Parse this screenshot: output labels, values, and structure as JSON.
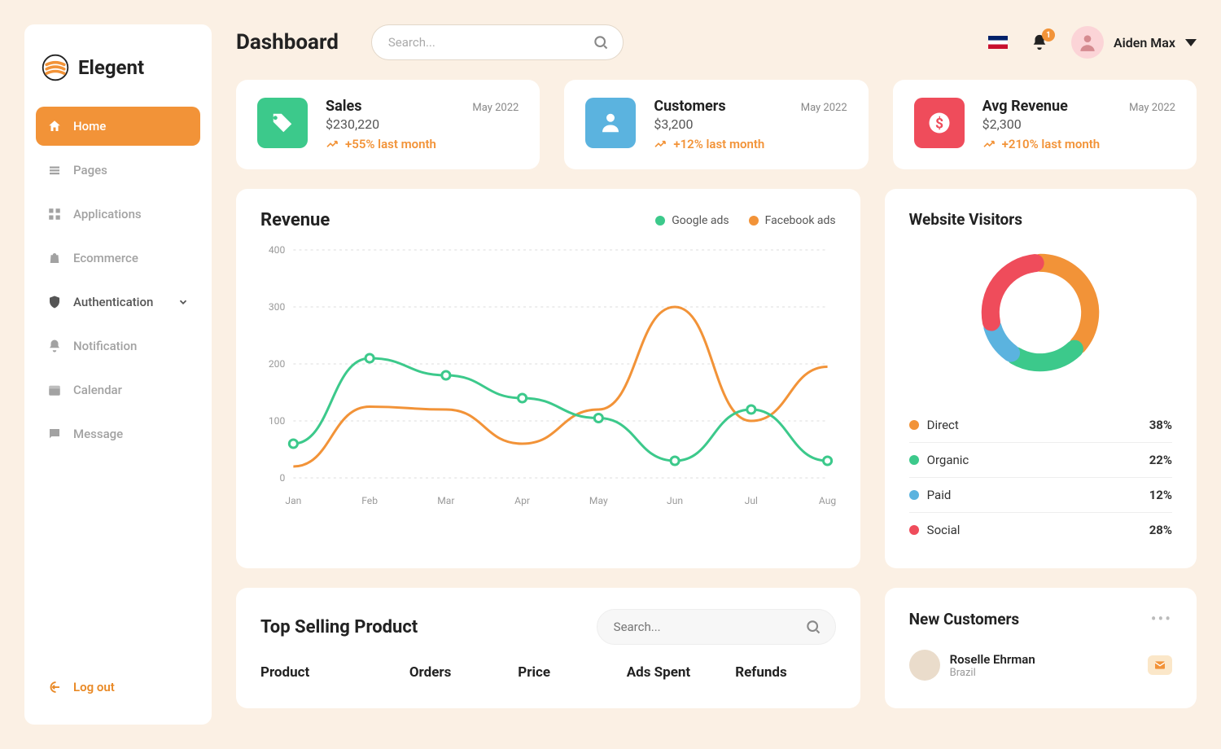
{
  "brand": "Elegent",
  "header": {
    "title": "Dashboard",
    "search_placeholder": "Search...",
    "notif_count": "1",
    "user_name": "Aiden Max"
  },
  "sidebar": {
    "items": [
      {
        "label": "Home"
      },
      {
        "label": "Pages"
      },
      {
        "label": "Applications"
      },
      {
        "label": "Ecommerce"
      },
      {
        "label": "Authentication"
      },
      {
        "label": "Notification"
      },
      {
        "label": "Calendar"
      },
      {
        "label": "Message"
      }
    ],
    "logout": "Log out"
  },
  "stats": [
    {
      "title": "Sales",
      "period": "May 2022",
      "value": "$230,220",
      "delta": "+55% last month"
    },
    {
      "title": "Customers",
      "period": "May 2022",
      "value": "$3,200",
      "delta": "+12% last month"
    },
    {
      "title": "Avg Revenue",
      "period": "May 2022",
      "value": "$2,300",
      "delta": "+210% last month"
    }
  ],
  "revenue": {
    "title": "Revenue",
    "legend": [
      "Google ads",
      "Facebook ads"
    ]
  },
  "visitors": {
    "title": "Website Visitors",
    "items": [
      {
        "label": "Direct",
        "value": "38%"
      },
      {
        "label": "Organic",
        "value": "22%"
      },
      {
        "label": "Paid",
        "value": "12%"
      },
      {
        "label": "Social",
        "value": "28%"
      }
    ]
  },
  "top_selling": {
    "title": "Top Selling Product",
    "search_placeholder": "Search...",
    "columns": [
      "Product",
      "Orders",
      "Price",
      "Ads Spent",
      "Refunds"
    ]
  },
  "new_customers": {
    "title": "New Customers",
    "items": [
      {
        "name": "Roselle Ehrman",
        "sub": "Brazil"
      }
    ]
  },
  "chart_data": [
    {
      "type": "line",
      "title": "Revenue",
      "categories": [
        "Jan",
        "Feb",
        "Mar",
        "Apr",
        "May",
        "Jun",
        "Jul",
        "Aug"
      ],
      "ylim": [
        0,
        400
      ],
      "ylabel": "",
      "xlabel": "",
      "series": [
        {
          "name": "Google ads",
          "values": [
            60,
            210,
            180,
            140,
            105,
            30,
            120,
            30
          ]
        },
        {
          "name": "Facebook ads",
          "values": [
            20,
            125,
            120,
            60,
            120,
            300,
            100,
            195
          ]
        }
      ]
    },
    {
      "type": "pie",
      "title": "Website Visitors",
      "categories": [
        "Direct",
        "Organic",
        "Paid",
        "Social"
      ],
      "values": [
        38,
        22,
        12,
        28
      ]
    }
  ]
}
